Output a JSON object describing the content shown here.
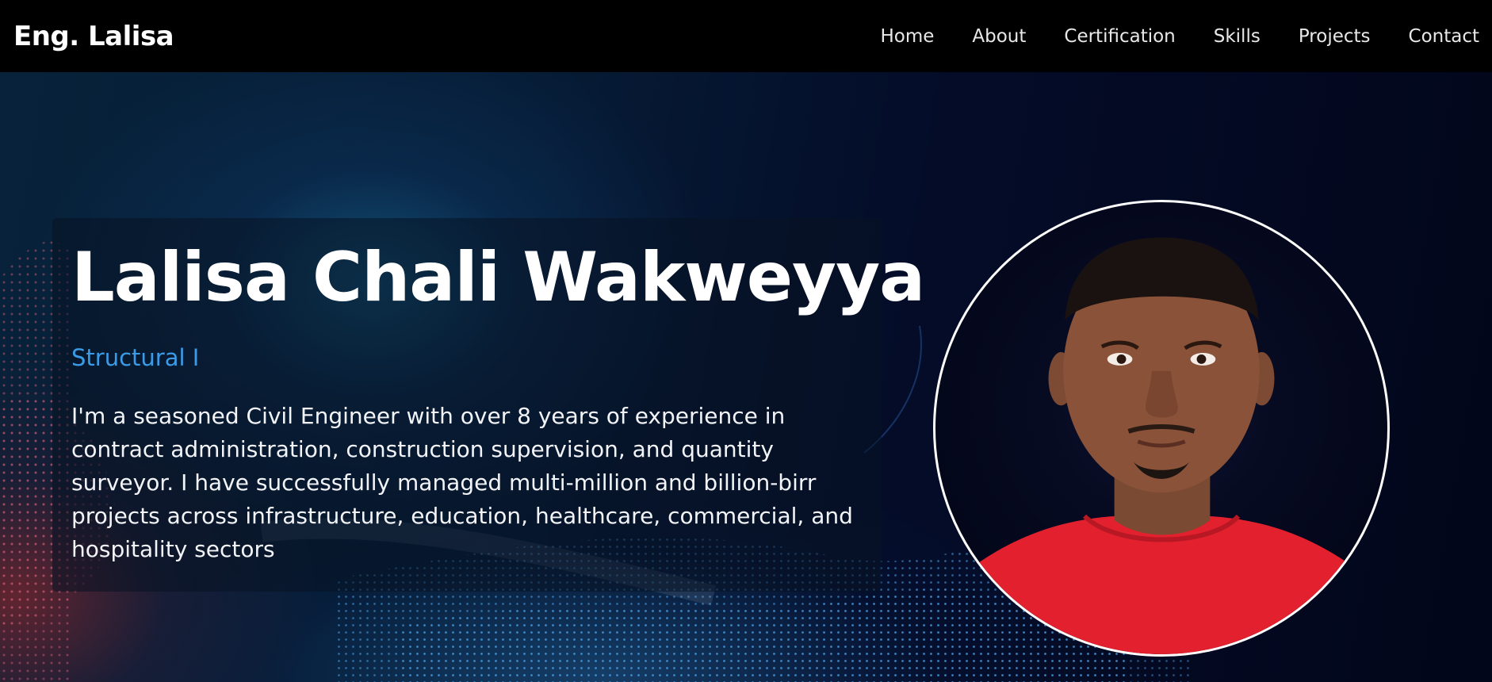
{
  "nav": {
    "brand": "Eng. Lalisa",
    "links": [
      "Home",
      "About",
      "Certification",
      "Skills",
      "Projects",
      "Contact"
    ]
  },
  "hero": {
    "name": "Lalisa Chali Wakweyya",
    "role": "Structural I",
    "bio": "I'm a seasoned Civil Engineer with over 8 years of experience in contract administration, construction supervision, and quantity surveyor. I have successfully managed multi-million and billion-birr projects across infrastructure, education, healthcare, commercial, and hospitality sectors"
  },
  "portrait": {
    "icon": "profile-photo"
  },
  "colors": {
    "nav_bg": "#000000",
    "accent": "#3b9be6",
    "hero_bg": "#02061a",
    "shirt": "#e3212e"
  }
}
